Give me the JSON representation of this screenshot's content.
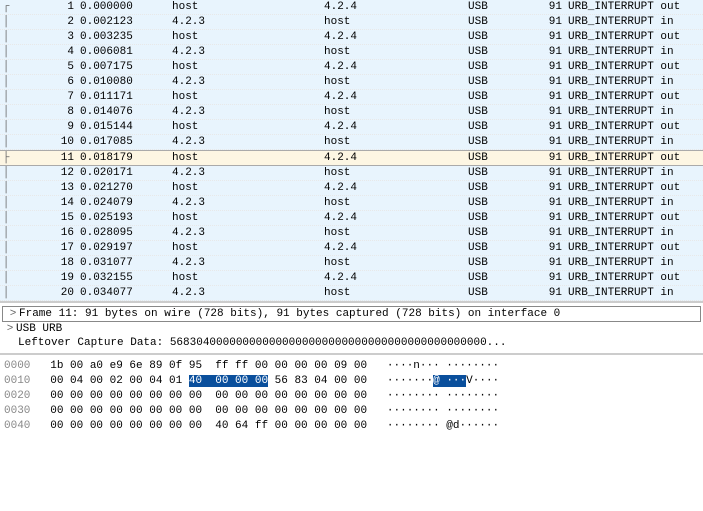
{
  "packet_list": {
    "selected_no": 11,
    "rows": [
      {
        "no": 1,
        "time": "0.000000",
        "src": "host",
        "dst": "4.2.4",
        "proto": "USB",
        "len": 91,
        "info": "URB_INTERRUPT out"
      },
      {
        "no": 2,
        "time": "0.002123",
        "src": "4.2.3",
        "dst": "host",
        "proto": "USB",
        "len": 91,
        "info": "URB_INTERRUPT in"
      },
      {
        "no": 3,
        "time": "0.003235",
        "src": "host",
        "dst": "4.2.4",
        "proto": "USB",
        "len": 91,
        "info": "URB_INTERRUPT out"
      },
      {
        "no": 4,
        "time": "0.006081",
        "src": "4.2.3",
        "dst": "host",
        "proto": "USB",
        "len": 91,
        "info": "URB_INTERRUPT in"
      },
      {
        "no": 5,
        "time": "0.007175",
        "src": "host",
        "dst": "4.2.4",
        "proto": "USB",
        "len": 91,
        "info": "URB_INTERRUPT out"
      },
      {
        "no": 6,
        "time": "0.010080",
        "src": "4.2.3",
        "dst": "host",
        "proto": "USB",
        "len": 91,
        "info": "URB_INTERRUPT in"
      },
      {
        "no": 7,
        "time": "0.011171",
        "src": "host",
        "dst": "4.2.4",
        "proto": "USB",
        "len": 91,
        "info": "URB_INTERRUPT out"
      },
      {
        "no": 8,
        "time": "0.014076",
        "src": "4.2.3",
        "dst": "host",
        "proto": "USB",
        "len": 91,
        "info": "URB_INTERRUPT in"
      },
      {
        "no": 9,
        "time": "0.015144",
        "src": "host",
        "dst": "4.2.4",
        "proto": "USB",
        "len": 91,
        "info": "URB_INTERRUPT out"
      },
      {
        "no": 10,
        "time": "0.017085",
        "src": "4.2.3",
        "dst": "host",
        "proto": "USB",
        "len": 91,
        "info": "URB_INTERRUPT in"
      },
      {
        "no": 11,
        "time": "0.018179",
        "src": "host",
        "dst": "4.2.4",
        "proto": "USB",
        "len": 91,
        "info": "URB_INTERRUPT out"
      },
      {
        "no": 12,
        "time": "0.020171",
        "src": "4.2.3",
        "dst": "host",
        "proto": "USB",
        "len": 91,
        "info": "URB_INTERRUPT in"
      },
      {
        "no": 13,
        "time": "0.021270",
        "src": "host",
        "dst": "4.2.4",
        "proto": "USB",
        "len": 91,
        "info": "URB_INTERRUPT out"
      },
      {
        "no": 14,
        "time": "0.024079",
        "src": "4.2.3",
        "dst": "host",
        "proto": "USB",
        "len": 91,
        "info": "URB_INTERRUPT in"
      },
      {
        "no": 15,
        "time": "0.025193",
        "src": "host",
        "dst": "4.2.4",
        "proto": "USB",
        "len": 91,
        "info": "URB_INTERRUPT out"
      },
      {
        "no": 16,
        "time": "0.028095",
        "src": "4.2.3",
        "dst": "host",
        "proto": "USB",
        "len": 91,
        "info": "URB_INTERRUPT in"
      },
      {
        "no": 17,
        "time": "0.029197",
        "src": "host",
        "dst": "4.2.4",
        "proto": "USB",
        "len": 91,
        "info": "URB_INTERRUPT out"
      },
      {
        "no": 18,
        "time": "0.031077",
        "src": "4.2.3",
        "dst": "host",
        "proto": "USB",
        "len": 91,
        "info": "URB_INTERRUPT in"
      },
      {
        "no": 19,
        "time": "0.032155",
        "src": "host",
        "dst": "4.2.4",
        "proto": "USB",
        "len": 91,
        "info": "URB_INTERRUPT out"
      },
      {
        "no": 20,
        "time": "0.034077",
        "src": "4.2.3",
        "dst": "host",
        "proto": "USB",
        "len": 91,
        "info": "URB_INTERRUPT in"
      }
    ]
  },
  "details": {
    "frame": "Frame 11: 91 bytes on wire (728 bits), 91 bytes captured (728 bits) on interface 0",
    "urb": "USB URB",
    "leftover": "Leftover Capture Data: 568304000000000000000000000000000000000000000000..."
  },
  "hexdump": {
    "rows": [
      {
        "offset": "0000",
        "bytes_pre": "1b 00 a0 e9 6e 89 0f 95  ff ff 00 00 00 00 09 00",
        "bytes_hl": "",
        "bytes_post": "",
        "ascii_pre": "····n··· ········",
        "ascii_hl": "",
        "ascii_post": ""
      },
      {
        "offset": "0010",
        "bytes_pre": "00 04 00 02 00 04 01 ",
        "bytes_hl": "40  00 00 00",
        "bytes_post": " 56 83 04 00 00",
        "ascii_pre": "·······",
        "ascii_hl": "@ ···",
        "ascii_post": "V····"
      },
      {
        "offset": "0020",
        "bytes_pre": "00 00 00 00 00 00 00 00  00 00 00 00 00 00 00 00",
        "bytes_hl": "",
        "bytes_post": "",
        "ascii_pre": "········ ········",
        "ascii_hl": "",
        "ascii_post": ""
      },
      {
        "offset": "0030",
        "bytes_pre": "00 00 00 00 00 00 00 00  00 00 00 00 00 00 00 00",
        "bytes_hl": "",
        "bytes_post": "",
        "ascii_pre": "········ ········",
        "ascii_hl": "",
        "ascii_post": ""
      },
      {
        "offset": "0040",
        "bytes_pre": "00 00 00 00 00 00 00 00  40 64 ff 00 00 00 00 00",
        "bytes_hl": "",
        "bytes_post": "",
        "ascii_pre": "········ @d······",
        "ascii_hl": "",
        "ascii_post": ""
      }
    ]
  }
}
